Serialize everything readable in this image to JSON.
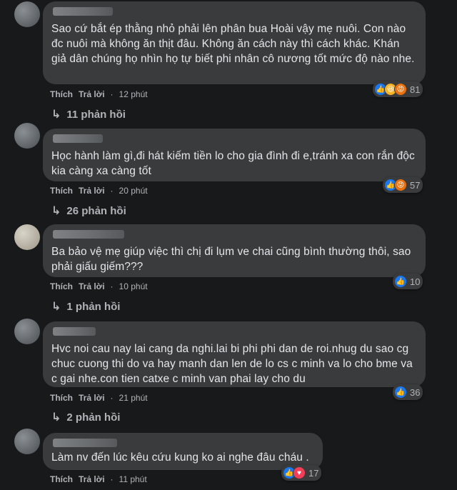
{
  "labels": {
    "like": "Thích",
    "reply": "Trả lời",
    "dot": "·"
  },
  "comments": [
    {
      "text": "Sao cứ bắt ép thằng nhỏ phải lên phân bua Hoài vậy mẹ nuôi. Con nào đc nuôi mà không ăn thịt đâu. Không ăn cách này thì cách khác. Khán giả dân chúng họ nhìn họ tự biết phi nhân cô nương tốt mức độ nào nhe.",
      "time": "12 phút",
      "reactions": [
        "like",
        "haha",
        "angry"
      ],
      "reaction_count": "81",
      "replies": "11 phản hồi"
    },
    {
      "text": "Học hành làm gì,đi hát kiếm tiền lo cho gia đình đi e,tránh xa con rắn độc kia càng xa càng tốt",
      "time": "20 phút",
      "reactions": [
        "like",
        "angry"
      ],
      "reaction_count": "57",
      "replies": "26 phản hồi"
    },
    {
      "text": "Ba bảo vệ mẹ giúp việc thì chị đi lụm ve chai cũng bình thường thôi, sao phải giấu giếm???",
      "time": "10 phút",
      "reactions": [
        "like"
      ],
      "reaction_count": "10",
      "replies": "1 phản hồi"
    },
    {
      "text": "Hvc noi cau nay lai cang da nghi.lai bi phi phi dan de roi.nhug du sao cg chuc cuong thi do va hay manh dan len de lo cs c minh va lo cho bme va c gai nhe.con tien catxe c minh van phai lay cho du",
      "time": "21 phút",
      "reactions": [
        "like"
      ],
      "reaction_count": "36",
      "replies": "2 phản hồi"
    },
    {
      "text": "Làm nv đến lúc kêu cứu kung ko ai nghe đâu cháu .",
      "time": "11 phút",
      "reactions": [
        "like",
        "love"
      ],
      "reaction_count": "17",
      "replies": ""
    }
  ]
}
